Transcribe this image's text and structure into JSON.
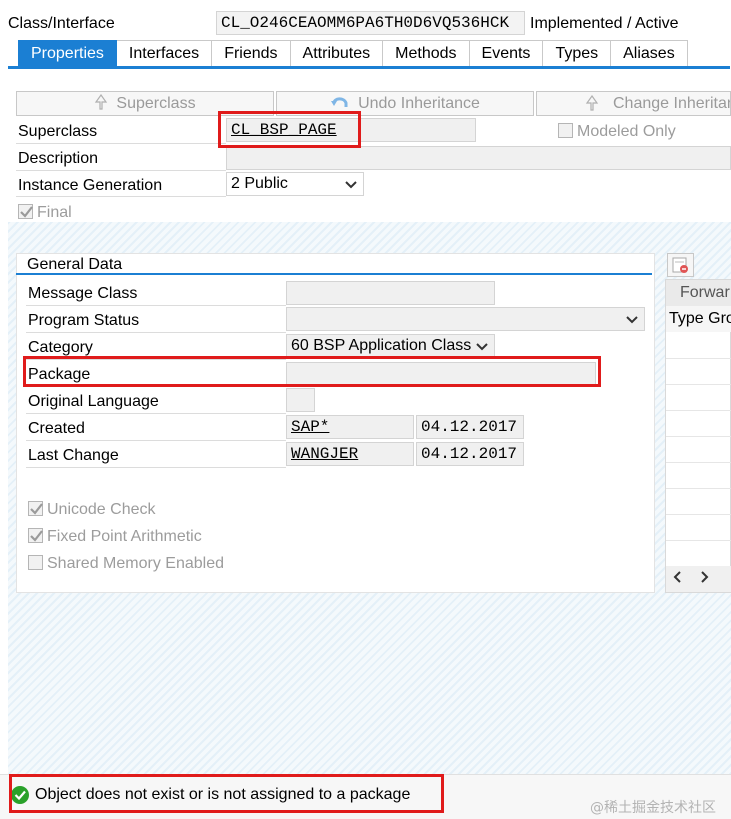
{
  "header": {
    "label": "Class/Interface",
    "class_name": "CL_O246CEAOMM6PA6TH0D6VQ536HCK",
    "status": "Implemented / Active"
  },
  "tabs": [
    "Properties",
    "Interfaces",
    "Friends",
    "Attributes",
    "Methods",
    "Events",
    "Types",
    "Aliases"
  ],
  "toolbar": {
    "superclass_btn": "Superclass",
    "undo_btn": "Undo Inheritance",
    "change_btn": "Change Inheritan"
  },
  "properties": {
    "superclass_label": "Superclass",
    "superclass_value": "CL_BSP_PAGE",
    "modeled_only": "Modeled Only",
    "description_label": "Description",
    "description_value": "",
    "instance_label": "Instance Generation",
    "instance_value": "2 Public",
    "final_label": "Final"
  },
  "general": {
    "title": "General Data",
    "message_class_label": "Message Class",
    "program_status_label": "Program Status",
    "category_label": "Category",
    "category_value": "60 BSP Application Class",
    "package_label": "Package",
    "package_value": "",
    "orig_lang_label": "Original Language",
    "created_label": "Created",
    "created_by": "SAP*",
    "created_date": "04.12.2017",
    "changed_label": "Last Change",
    "changed_by": "WANGJER",
    "changed_date": "04.12.2017",
    "unicode_check": "Unicode Check",
    "fixed_point": "Fixed Point Arithmetic",
    "shared_memory": "Shared Memory Enabled"
  },
  "side_panel": {
    "col1": "Forwar",
    "col2": "Type Gro"
  },
  "status_bar": {
    "message": "Object does not exist or is not assigned to a package"
  },
  "watermark": "@稀土掘金技术社区",
  "colors": {
    "accent": "#1b7fd3",
    "highlight": "#e01b1b",
    "success": "#2aa12a"
  }
}
